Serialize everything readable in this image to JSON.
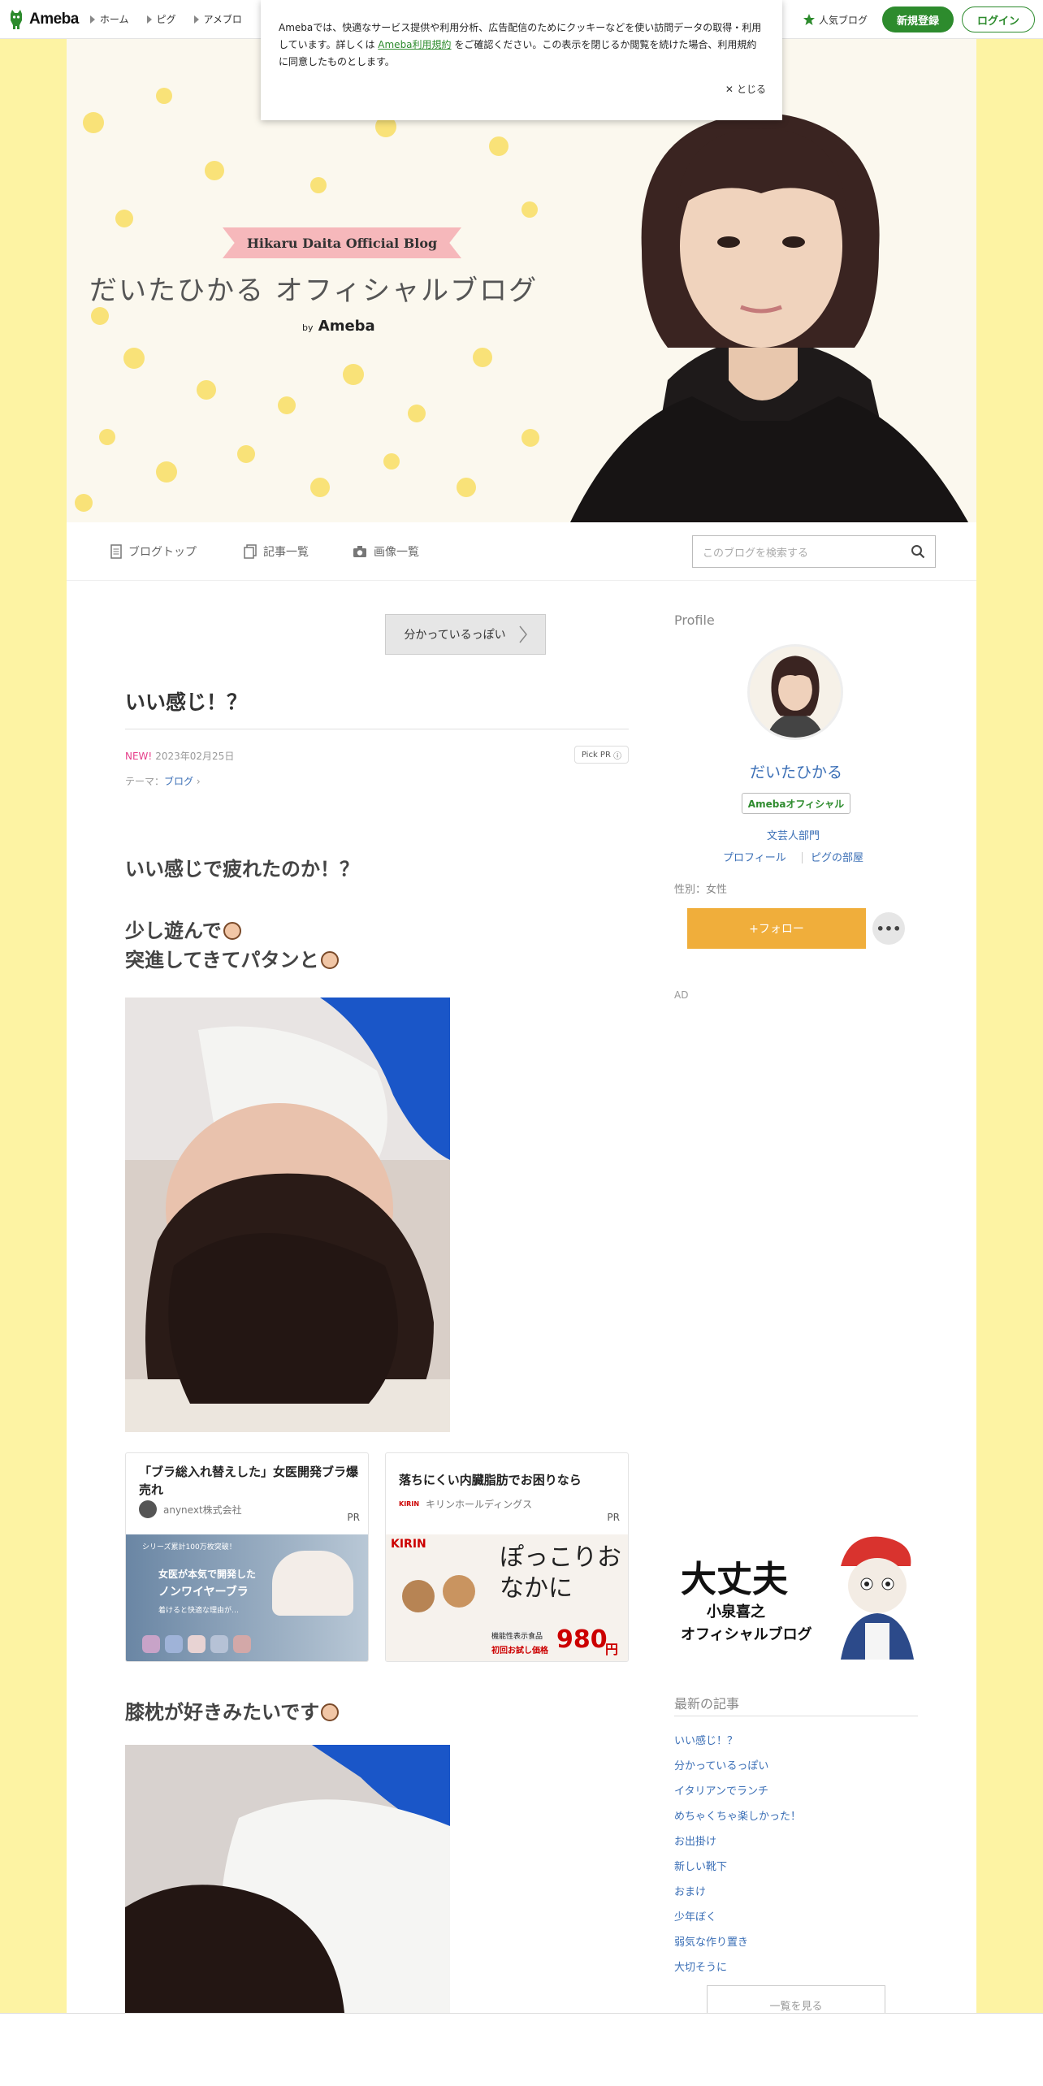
{
  "topbar": {
    "logo_text": "Ameba",
    "nav": [
      "ホーム",
      "ピグ",
      "アメブロ"
    ],
    "popular": "人気ブログ",
    "register": "新規登録",
    "login": "ログイン"
  },
  "cookie": {
    "text_before": "Amebaでは、快適なサービス提供や利用分析、広告配信のためにクッキーなどを使い訪問データの取得・利用しています。詳しくは",
    "link": "Ameba利用規約",
    "text_after": "をご確認ください。この表示を閉じるか閲覧を続けた場合、利用規約に同意したものとします。",
    "close": "とじる"
  },
  "header": {
    "ribbon": "Hikaru Daita Official Blog",
    "title": "だいたひかる オフィシャルブログ",
    "by": "by",
    "brand": "Ameba"
  },
  "blognav": {
    "items": [
      "ブログトップ",
      "記事一覧",
      "画像一覧"
    ],
    "search_placeholder": "このブログを検索する"
  },
  "article": {
    "prev_button": "分かっているっぽい",
    "title": "いい感じ！？",
    "new_label": "NEW!",
    "date": "2023年02月25日",
    "pick_pr": "Pick PR",
    "theme_label": "テーマ：",
    "theme": "ブログ",
    "lines": [
      "いい感じで疲れたのか！？",
      "少し遊んで",
      "突進してきてパタンと"
    ],
    "sub_heading": "膝枕が好きみたいです"
  },
  "ads": [
    {
      "title": "「ブラ総入れ替えした」女医開発ブラ爆売れ",
      "sponsor": "anynext株式会社",
      "pr": "PR",
      "img_lines": [
        "シリーズ累計100万枚突破！",
        "女医が本気で開発した",
        "ノンワイヤーブラ",
        "着けると快適な理由が…"
      ]
    },
    {
      "title": "落ちにくい内臓脂肪でお困りなら",
      "sponsor": "キリンホールディングス",
      "pr": "PR",
      "img_brand": "KIRIN",
      "img_text": "ぽっこりおなかに",
      "img_sub": "機能性表示食品",
      "img_note": "初回お試し価格",
      "img_price": "980",
      "img_yen": "円"
    }
  ],
  "sidebar": {
    "profile_label": "Profile",
    "name": "だいたひかる",
    "official": "Amebaオフィシャル",
    "category": "文芸人部門",
    "profile_link": "プロフィール",
    "pigg_link": "ピグの部屋",
    "gender": "性別：女性",
    "follow": "+フォロー",
    "more": "•••",
    "ad": "AD",
    "banner_line1": "大丈夫",
    "banner_line2": "小泉喜之",
    "banner_line3": "オフィシャルブログ",
    "recent_title": "最新の記事",
    "recent": [
      "いい感じ！？",
      "分かっているっぽい",
      "イタリアンでランチ",
      "めちゃくちゃ楽しかった！",
      "お出掛け",
      "新しい靴下",
      "おまけ",
      "少年ぼく",
      "弱気な作り置き",
      "大切そうに"
    ],
    "list_button": "一覧を見る"
  },
  "colors": {
    "bg": "#fdf3a3",
    "green": "#2d8b2d",
    "link": "#3b6fb6",
    "follow": "#f0ae3b",
    "new": "#e63e8a"
  }
}
